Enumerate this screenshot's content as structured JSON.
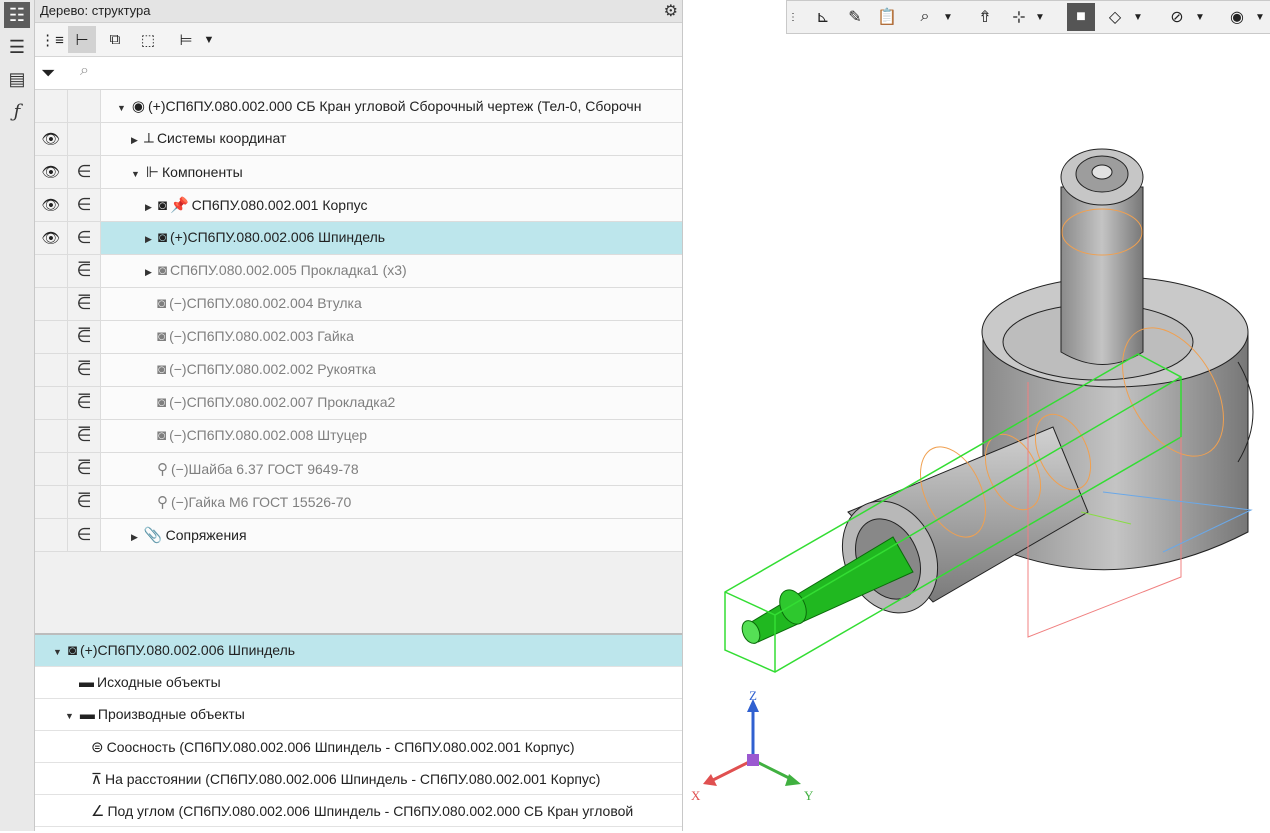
{
  "tree_panel": {
    "title": "Дерево: структура",
    "rows": [
      {
        "label": "(+)СП6ПУ.080.002.000 СБ Кран угловой Сборочный чертеж (Тел-0, Сборочн"
      },
      {
        "label": "Системы координат"
      },
      {
        "label": "Компоненты"
      },
      {
        "label": "СП6ПУ.080.002.001 Корпус"
      },
      {
        "label": "(+)СП6ПУ.080.002.006 Шпиндель"
      },
      {
        "label": "СП6ПУ.080.002.005 Прокладка1 (x3)"
      },
      {
        "label": "(−)СП6ПУ.080.002.004 Втулка"
      },
      {
        "label": "(−)СП6ПУ.080.002.003 Гайка"
      },
      {
        "label": "(−)СП6ПУ.080.002.002 Рукоятка"
      },
      {
        "label": "(−)СП6ПУ.080.002.007 Прокладка2"
      },
      {
        "label": "(−)СП6ПУ.080.002.008 Штуцер"
      },
      {
        "label": "(−)Шайба 6.37 ГОСТ 9649-78"
      },
      {
        "label": "(−)Гайка М6 ГОСТ 15526-70"
      },
      {
        "label": "Сопряжения"
      }
    ]
  },
  "detail_panel": {
    "rows": [
      {
        "label": "(+)СП6ПУ.080.002.006 Шпиндель"
      },
      {
        "label": "Исходные объекты"
      },
      {
        "label": "Производные объекты"
      },
      {
        "label": "Соосность (СП6ПУ.080.002.006 Шпиндель  -  СП6ПУ.080.002.001 Корпус)"
      },
      {
        "label": "На расстоянии (СП6ПУ.080.002.006 Шпиндель  -  СП6ПУ.080.002.001 Корпус)"
      },
      {
        "label": "Под углом (СП6ПУ.080.002.006 Шпиндель  -  СП6ПУ.080.002.000 СБ Кран угловой"
      }
    ]
  },
  "axes": {
    "x": "X",
    "y": "Y",
    "z": "Z"
  },
  "colors": {
    "selection": "#bde6ec",
    "highlight": "#00cc00",
    "hidden_outline": "#f0a050",
    "axis_x": "#e05050",
    "axis_y": "#40b040",
    "axis_z": "#3060d0"
  }
}
